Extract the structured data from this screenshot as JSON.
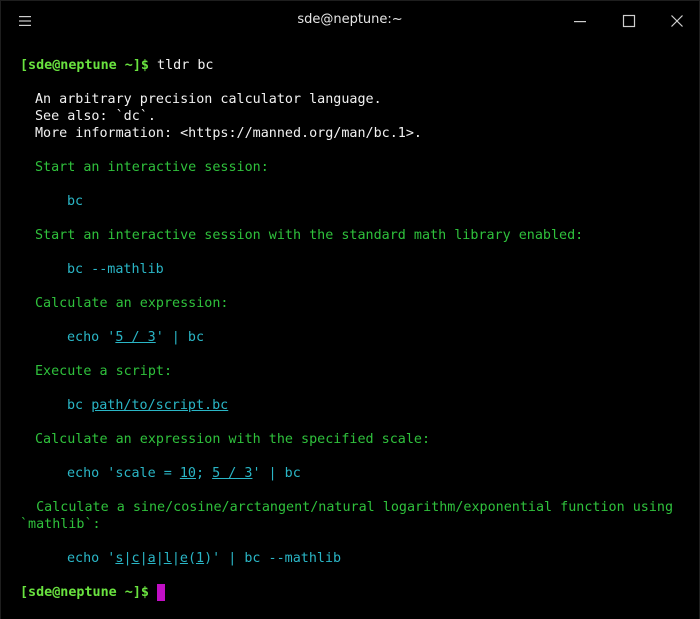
{
  "window": {
    "title": "sde@neptune:~",
    "menu_icon": "hamburger-menu-icon",
    "minimize_icon": "minimize-icon",
    "maximize_icon": "maximize-icon",
    "close_icon": "close-icon"
  },
  "colors": {
    "background": "#000000",
    "prompt": "#69e23f",
    "description": "#2fc13c",
    "command": "#2ab6c6",
    "text": "#f2f2f2",
    "cursor": "#c20fc6"
  },
  "terminal": {
    "prompt1": "[sde@neptune ~]$",
    "command1": " tldr bc",
    "intro": [
      "An arbitrary precision calculator language.",
      "See also: `dc`.",
      "More information: <https://manned.org/man/bc.1>."
    ],
    "examples": [
      {
        "desc": "Start an interactive session:",
        "cmd": "bc"
      },
      {
        "desc": "Start an interactive session with the standard math library enabled:",
        "cmd": "bc --mathlib"
      },
      {
        "desc": "Calculate an expression:",
        "cmd_pre": "echo '",
        "cmd_arg": "5 / 3",
        "cmd_post": "' | bc"
      },
      {
        "desc": "Execute a script:",
        "cmd_pre": "bc ",
        "cmd_arg": "path/to/script.bc"
      },
      {
        "desc": "Calculate an expression with the specified scale:",
        "cmd_pre": "echo 'scale = ",
        "cmd_arg1": "10",
        "cmd_mid": "; ",
        "cmd_arg2": "5 / 3",
        "cmd_post": "' | bc"
      },
      {
        "desc_line1": "  Calculate a sine/cosine/arctangent/natural logarithm/exponential function using",
        "desc_line2": "`mathlib`:",
        "cmd_pre": "echo '",
        "cmd_parts": [
          "s",
          "|",
          "c",
          "|",
          "a",
          "|",
          "l",
          "|",
          "e",
          "(",
          "1",
          ")"
        ],
        "cmd_post": "' | bc --mathlib"
      }
    ],
    "prompt2": "[sde@neptune ~]$",
    "command2": " "
  }
}
